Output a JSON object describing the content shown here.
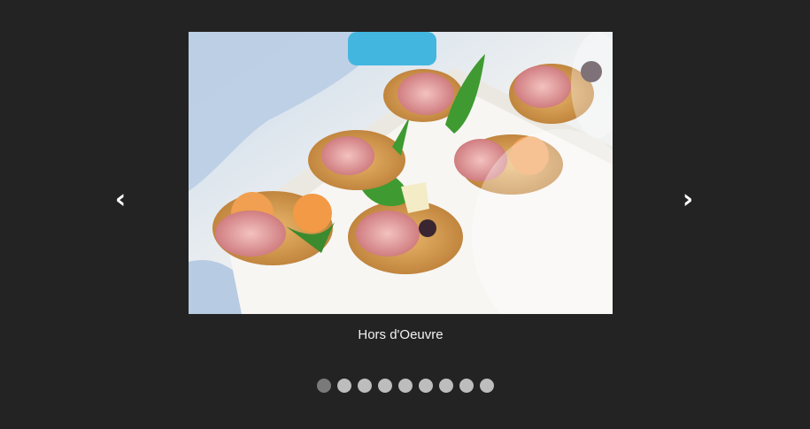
{
  "slideshow": {
    "prev_label": "‹",
    "next_label": "›",
    "caption": "Hors d'Oeuvre",
    "slide_count": 9,
    "active_slide": 1
  },
  "colors": {
    "background": "#232323",
    "dot_inactive": "#bdbdbd",
    "dot_active": "#7a7a7a",
    "caption_text": "#f2f2f2"
  }
}
